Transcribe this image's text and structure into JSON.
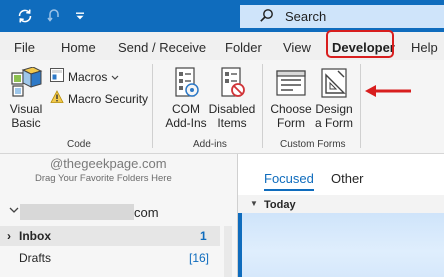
{
  "search": {
    "label": "Search"
  },
  "tabs": {
    "file": "File",
    "home": "Home",
    "send_receive": "Send / Receive",
    "folder": "Folder",
    "view": "View",
    "developer": "Developer",
    "help": "Help"
  },
  "ribbon": {
    "visual_basic": [
      "Visual",
      "Basic"
    ],
    "macros": "Macros",
    "macro_security": "Macro Security",
    "com_addins": [
      "COM",
      "Add-Ins"
    ],
    "disabled_items": [
      "Disabled",
      "Items"
    ],
    "choose_form": [
      "Choose",
      "Form"
    ],
    "design_form": [
      "Design",
      "a Form"
    ],
    "groups": {
      "code": "Code",
      "addins": "Add-ins",
      "custom_forms": "Custom Forms"
    }
  },
  "folders": {
    "watermark": "@thegeekpage.com",
    "drag_hint": "Drag Your Favorite Folders Here",
    "account_domain": "com",
    "items": [
      {
        "label": "Inbox",
        "count": "1"
      },
      {
        "label": "Drafts",
        "count": "[16]"
      }
    ]
  },
  "mail": {
    "tab_focused": "Focused",
    "tab_other": "Other",
    "group_today": "Today"
  },
  "colors": {
    "accent": "#0f6cbd",
    "highlight": "#d81e1e"
  }
}
